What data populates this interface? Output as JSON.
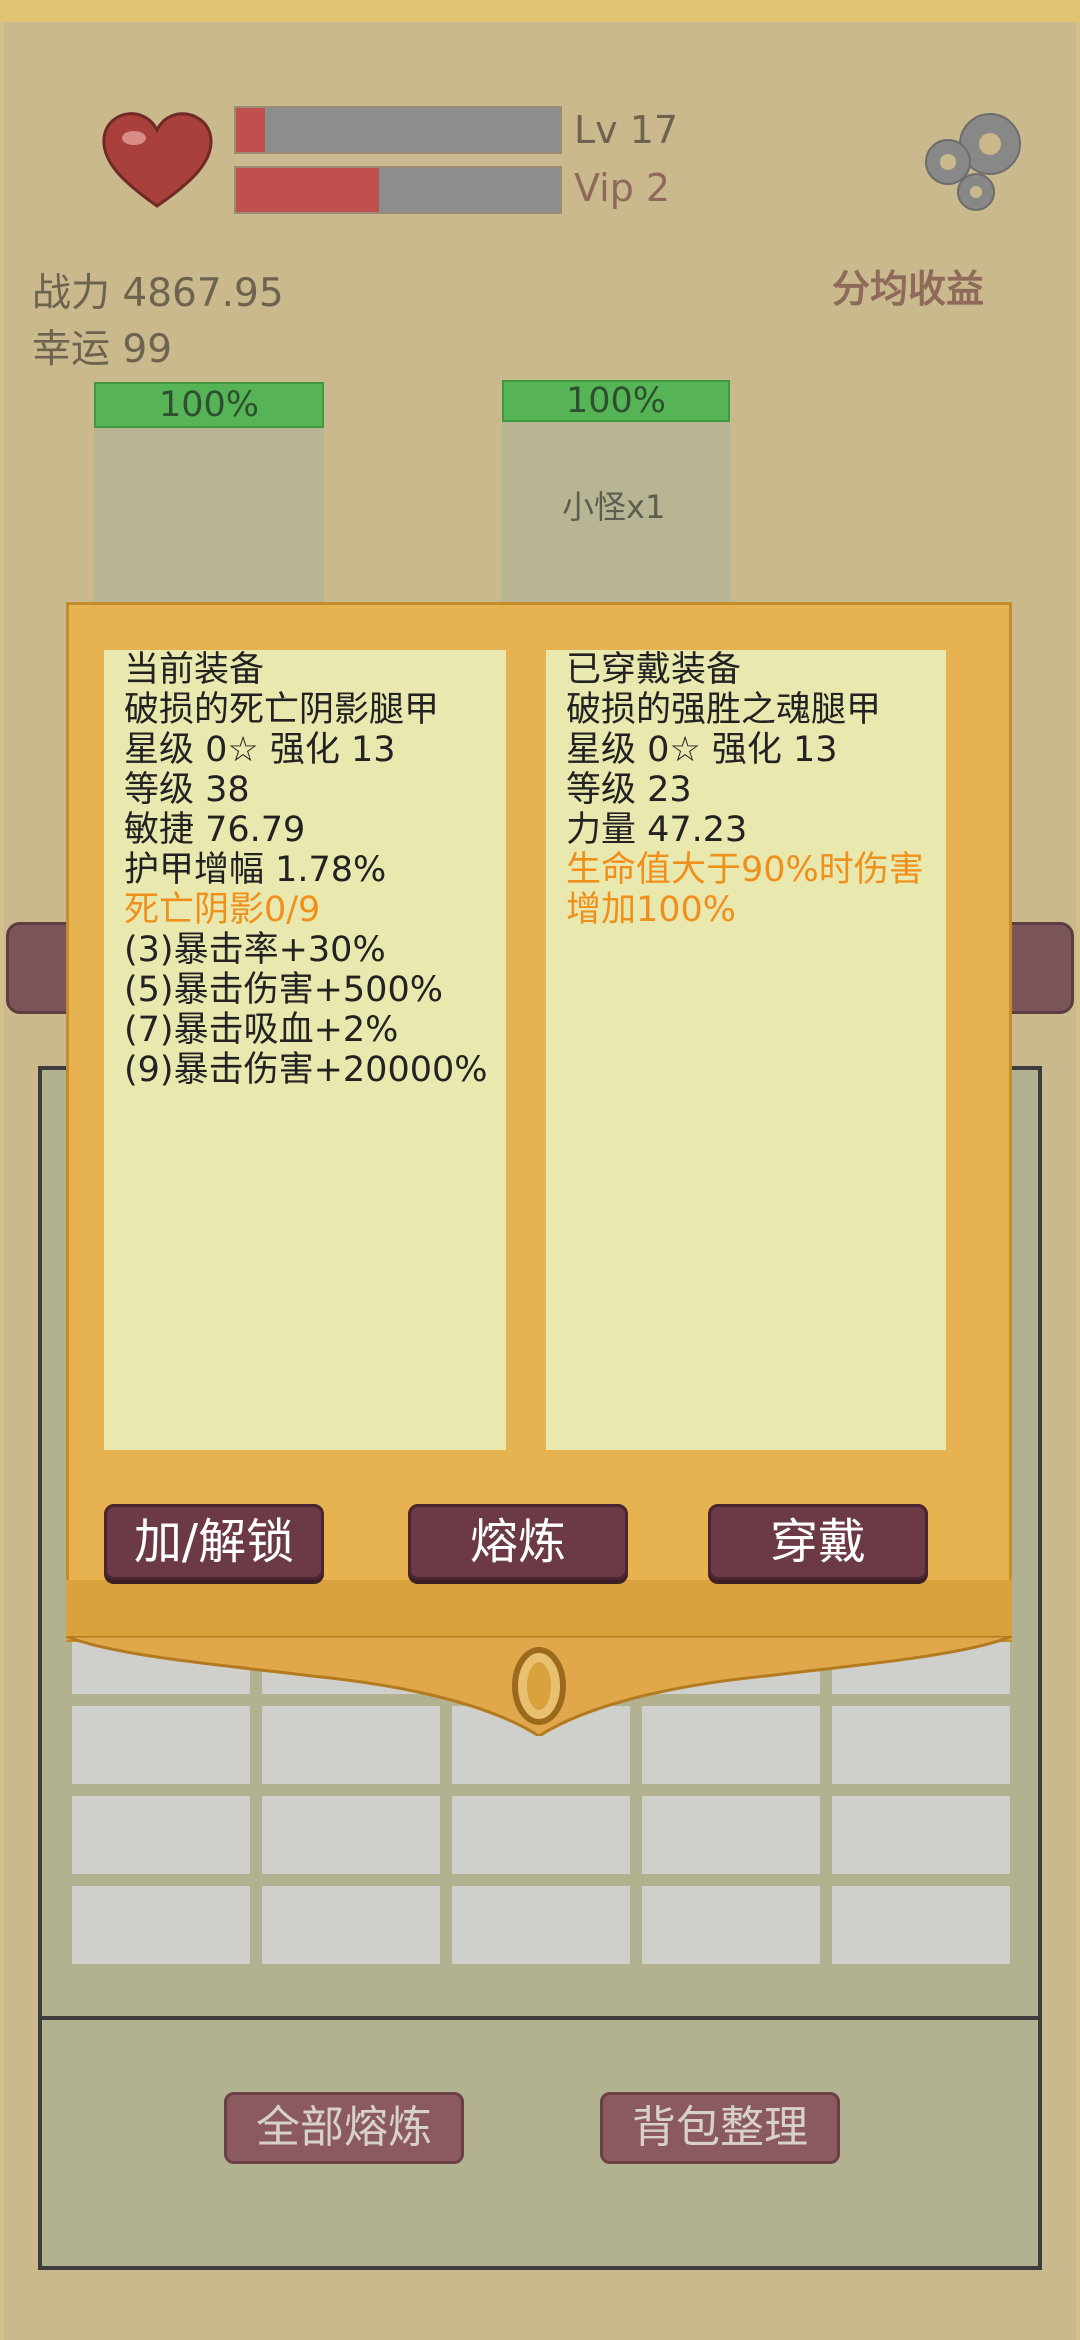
{
  "header": {
    "level": "Lv 17",
    "vip": "Vip 2",
    "level_progress": 0.09,
    "vip_progress": 0.44,
    "heart_icon": "heart-icon",
    "settings_icon": "gear-icon"
  },
  "stats": {
    "power": "战力 4867.95",
    "luck": "幸运 99",
    "earnings_label": "分均收益"
  },
  "battle": {
    "player_hp": "100%",
    "enemy_hp": "100%",
    "enemy_label": "小怪x1"
  },
  "modal": {
    "current": {
      "title": "当前装备",
      "name": "破损的死亡阴影腿甲",
      "star": "星级 0☆ 强化 13",
      "level": "等级 38",
      "attr1": "敏捷 76.79",
      "attr2": "护甲增幅 1.78%",
      "set_name": "死亡阴影0/9",
      "set_bonuses": [
        "(3)暴击率+30%",
        "(5)暴击伤害+500%",
        "(7)暴击吸血+2%",
        "(9)暴击伤害+20000%"
      ]
    },
    "equipped": {
      "title": "已穿戴装备",
      "name": "破损的强胜之魂腿甲",
      "star": "星级 0☆ 强化 13",
      "level": "等级 23",
      "attr1": "力量 47.23",
      "special": "生命值大于90%时伤害增加100%"
    },
    "buttons": {
      "lock": "加/解锁",
      "smelt": "熔炼",
      "wear": "穿戴"
    }
  },
  "inventory": {
    "smelt_all": "全部熔炼",
    "sort_bag": "背包整理"
  },
  "colors": {
    "accent_orange": "#f0901c",
    "hp_green": "#56b456",
    "bar_red": "#c0504d",
    "button_maroon": "#6b3a44"
  }
}
